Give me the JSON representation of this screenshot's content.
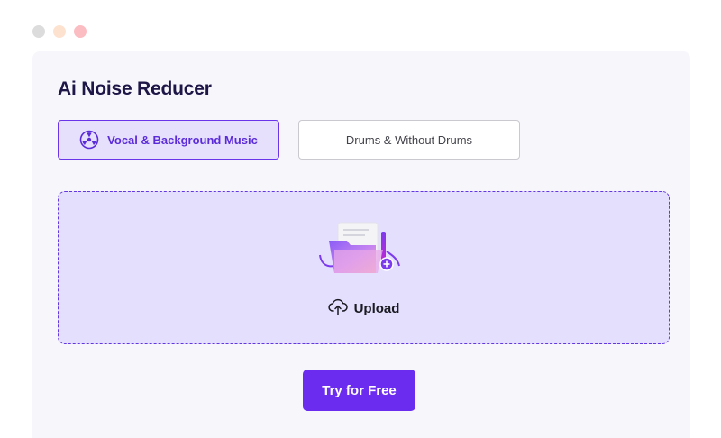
{
  "window": {
    "dot_colors": [
      "#dcdcdc",
      "#fde2cf",
      "#fbbcc2"
    ]
  },
  "panel": {
    "title": "Ai Noise Reducer"
  },
  "tabs": [
    {
      "label": "Vocal & Background Music",
      "icon": "vocal-music-icon",
      "active": true
    },
    {
      "label": "Drums & Without Drums",
      "icon": null,
      "active": false
    }
  ],
  "upload": {
    "label": "Upload",
    "icon": "cloud-upload-icon",
    "illustration": "folder-upload-illustration"
  },
  "cta": {
    "label": "Try for Free"
  },
  "colors": {
    "accent": "#6b2cf0",
    "accent_light": "#e5dffe",
    "title": "#1d1647"
  }
}
